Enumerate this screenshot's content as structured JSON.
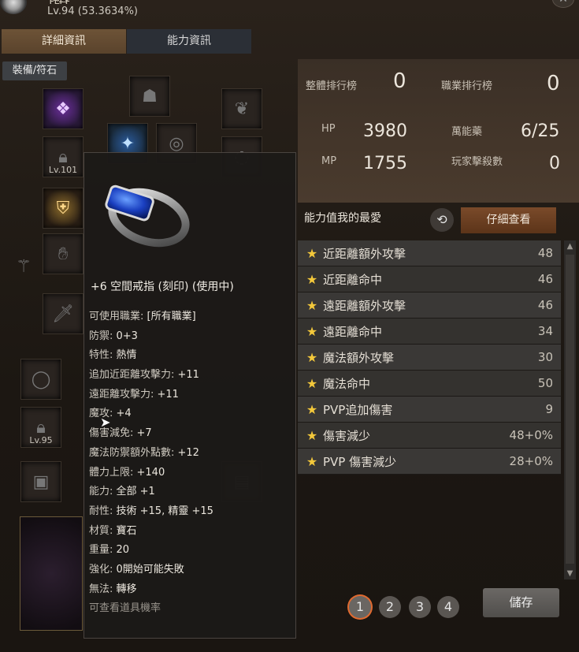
{
  "header": {
    "name": "Ƭ̵ʟ̴ᵲ̶ʏ̵",
    "level": "Lv.94 (53.3634%)"
  },
  "tabs": [
    {
      "label": "詳細資訊"
    },
    {
      "label": "能力資訊"
    }
  ],
  "sub_tab": "裝備/符石",
  "slots": {
    "lv101": "Lv.101",
    "lv95": "Lv.95"
  },
  "ranking": {
    "overall_label": "整體排行榜",
    "overall_value": "0",
    "class_label": "職業排行榜",
    "class_value": "0"
  },
  "stats": {
    "hp_label": "HP",
    "hp_value": "3980",
    "mp_label": "MP",
    "mp_value": "1755",
    "elixir_label": "萬能藥",
    "elixir_value": "6/25",
    "pk_label": "玩家擊殺數",
    "pk_value": "0"
  },
  "favorites": {
    "title": "能力值我的最愛",
    "detail_button": "仔細查看",
    "items": [
      {
        "name": "近距離額外攻擊",
        "value": "48"
      },
      {
        "name": "近距離命中",
        "value": "46"
      },
      {
        "name": "遠距離額外攻擊",
        "value": "46"
      },
      {
        "name": "遠距離命中",
        "value": "34"
      },
      {
        "name": "魔法額外攻擊",
        "value": "30"
      },
      {
        "name": "魔法命中",
        "value": "50"
      },
      {
        "name": "PVP追加傷害",
        "value": "9"
      },
      {
        "name": "傷害減少",
        "value": "48+0%"
      },
      {
        "name": "PVP 傷害減少",
        "value": "28+0%"
      }
    ]
  },
  "pages": [
    "1",
    "2",
    "3",
    "4"
  ],
  "save_button": "儲存",
  "tooltip": {
    "title": "+6 空間戒指 (刻印) (使用中)",
    "lines": [
      {
        "label": "可使用職業: ",
        "value": "[所有職業]"
      },
      {
        "label": "防禦: ",
        "value": "0+3"
      },
      {
        "label": "特性: ",
        "value": "熱情"
      },
      {
        "label": "追加近距離攻擊力: ",
        "value": "+11"
      },
      {
        "label": "遠距離攻擊力: ",
        "value": "+11"
      },
      {
        "label": "魔攻: ",
        "value": "+4"
      },
      {
        "label": "傷害減免: ",
        "value": "+7"
      },
      {
        "label": "魔法防禦額外點數: ",
        "value": "+12"
      },
      {
        "label": "體力上限: ",
        "value": "+140"
      },
      {
        "label": "能力: ",
        "value": "全部 +1"
      },
      {
        "label": "耐性: ",
        "value": "技術 +15, 精靈 +15"
      },
      {
        "label": "材質: ",
        "value": "寶石"
      },
      {
        "label": "重量: ",
        "value": "20"
      },
      {
        "label": "強化: ",
        "value": "0開始可能失敗"
      },
      {
        "label": "無法: ",
        "value": "轉移"
      }
    ],
    "footer": "可查看道具機率"
  },
  "colors": {
    "accent_orange": "#e06a30",
    "star": "#f3c83b",
    "tab_active": "#6d5337"
  }
}
